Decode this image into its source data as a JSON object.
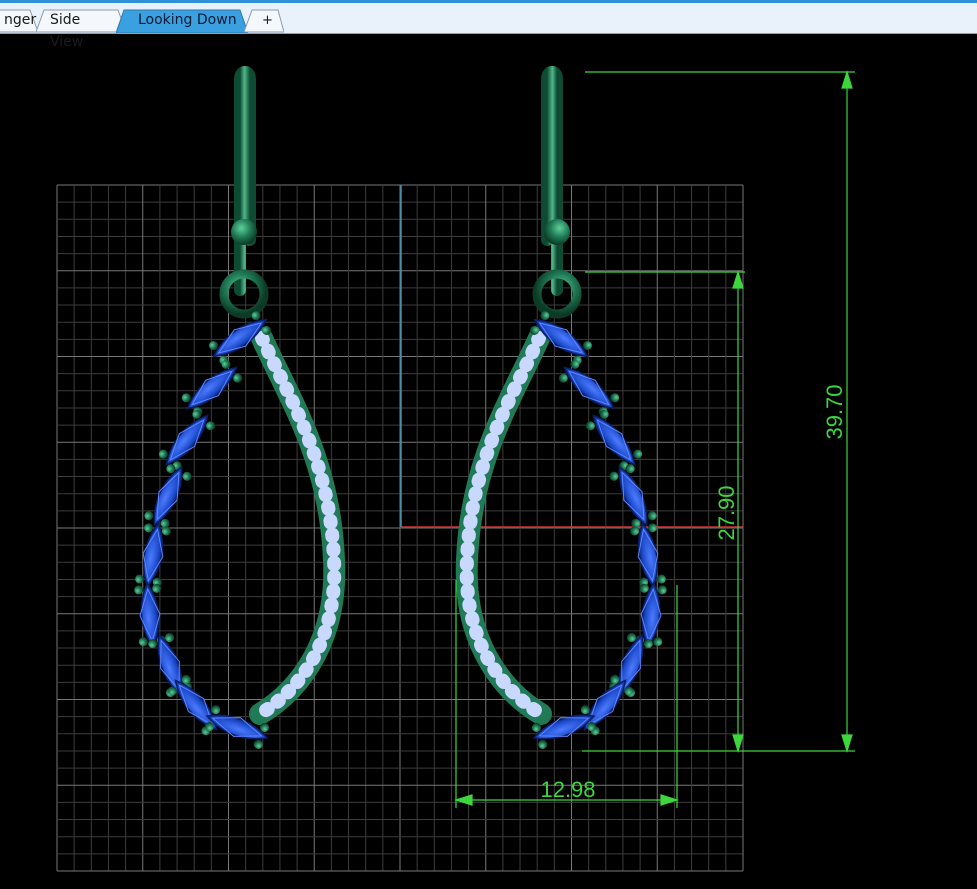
{
  "tabs": [
    {
      "label": "nger",
      "active": false
    },
    {
      "label": "Side View",
      "active": false
    },
    {
      "label": "Looking Down",
      "active": true
    },
    {
      "label": "+",
      "active": false,
      "is_add": true
    }
  ],
  "dimensions": {
    "total_height": "39.70",
    "drop_height": "27.90",
    "drop_width": "12.98"
  },
  "colors": {
    "metal": "#1f7a55",
    "metal_highlight": "#4fc08d",
    "marquise_stone": "#1a48c8",
    "round_stone": "#c8d8ff",
    "dimension_line": "#3dd63d",
    "grid": "#5a5a5a",
    "axis_x": "#d23030",
    "axis_y": "#3b93b3",
    "active_tab": "#3aa0e0"
  }
}
